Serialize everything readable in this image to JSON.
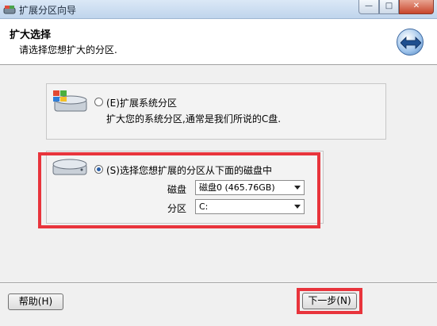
{
  "window": {
    "title": "扩展分区向导",
    "min_label": "—",
    "max_label": "□",
    "close_label": "✕"
  },
  "header": {
    "title": "扩大选择",
    "subtitle": "请选择您想扩大的分区."
  },
  "options": [
    {
      "label": "(E)扩展系统分区",
      "description": "扩大您的系统分区,通常是我们所说的C盘.",
      "checked": false
    },
    {
      "label": "(S)选择您想扩展的分区从下面的磁盘中",
      "checked": true
    }
  ],
  "disk_field": {
    "label": "磁盘",
    "value": "磁盘0 (465.76GB)"
  },
  "partition_field": {
    "label": "分区",
    "value": "C:"
  },
  "buttons": {
    "help": "帮助(H)",
    "next": "下一步(N)"
  },
  "colors": {
    "highlight_border": "#e8343c",
    "header_bg": "#ffffff",
    "dialog_bg": "#f0f0f0"
  }
}
